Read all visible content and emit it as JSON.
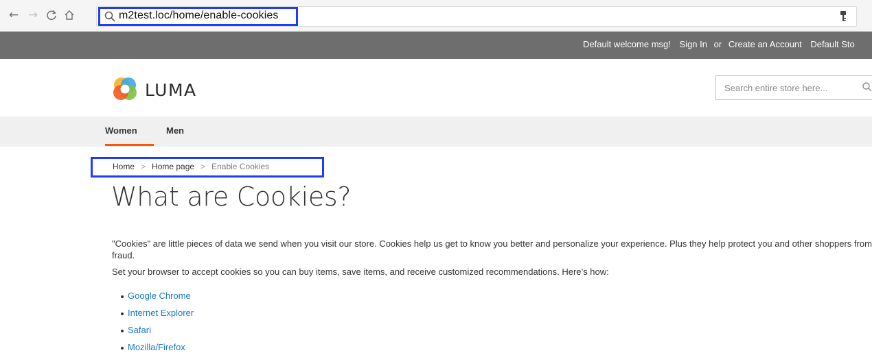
{
  "browser": {
    "back_icon": "←",
    "forward_icon": "→",
    "reload_icon": "C",
    "home_icon": "⌂",
    "url": "m2test.loc/home/enable-cookies"
  },
  "top_panel": {
    "welcome": "Default welcome msg!",
    "sign_in": "Sign In",
    "or": "or",
    "create_account": "Create an Account",
    "store": "Default Sto"
  },
  "header": {
    "logo_text": "LUMA",
    "search_placeholder": "Search entire store here..."
  },
  "nav": {
    "items": [
      {
        "label": "Women"
      },
      {
        "label": "Men"
      }
    ]
  },
  "breadcrumb": {
    "home": "Home",
    "home_page": "Home page",
    "current": "Enable Cookies",
    "separator": ">"
  },
  "content": {
    "title": "What are Cookies?",
    "paragraph1": "\"Cookies\" are little pieces of data we send when you visit our store. Cookies help us get to know you better and personalize your experience. Plus they help protect you and other shoppers from fraud.",
    "paragraph2": "Set your browser to accept cookies so you can buy items, save items, and receive customized recommendations. Here’s how:",
    "links": [
      {
        "label": "Google Chrome"
      },
      {
        "label": "Internet Explorer"
      },
      {
        "label": "Safari"
      },
      {
        "label": "Mozilla/Firefox"
      }
    ]
  },
  "colors": {
    "top_panel": "#6e6e6e",
    "nav_bg": "#f0f0f0",
    "accent": "#ff5501",
    "link": "#1979c3",
    "highlight_box": "#1e3cff"
  }
}
